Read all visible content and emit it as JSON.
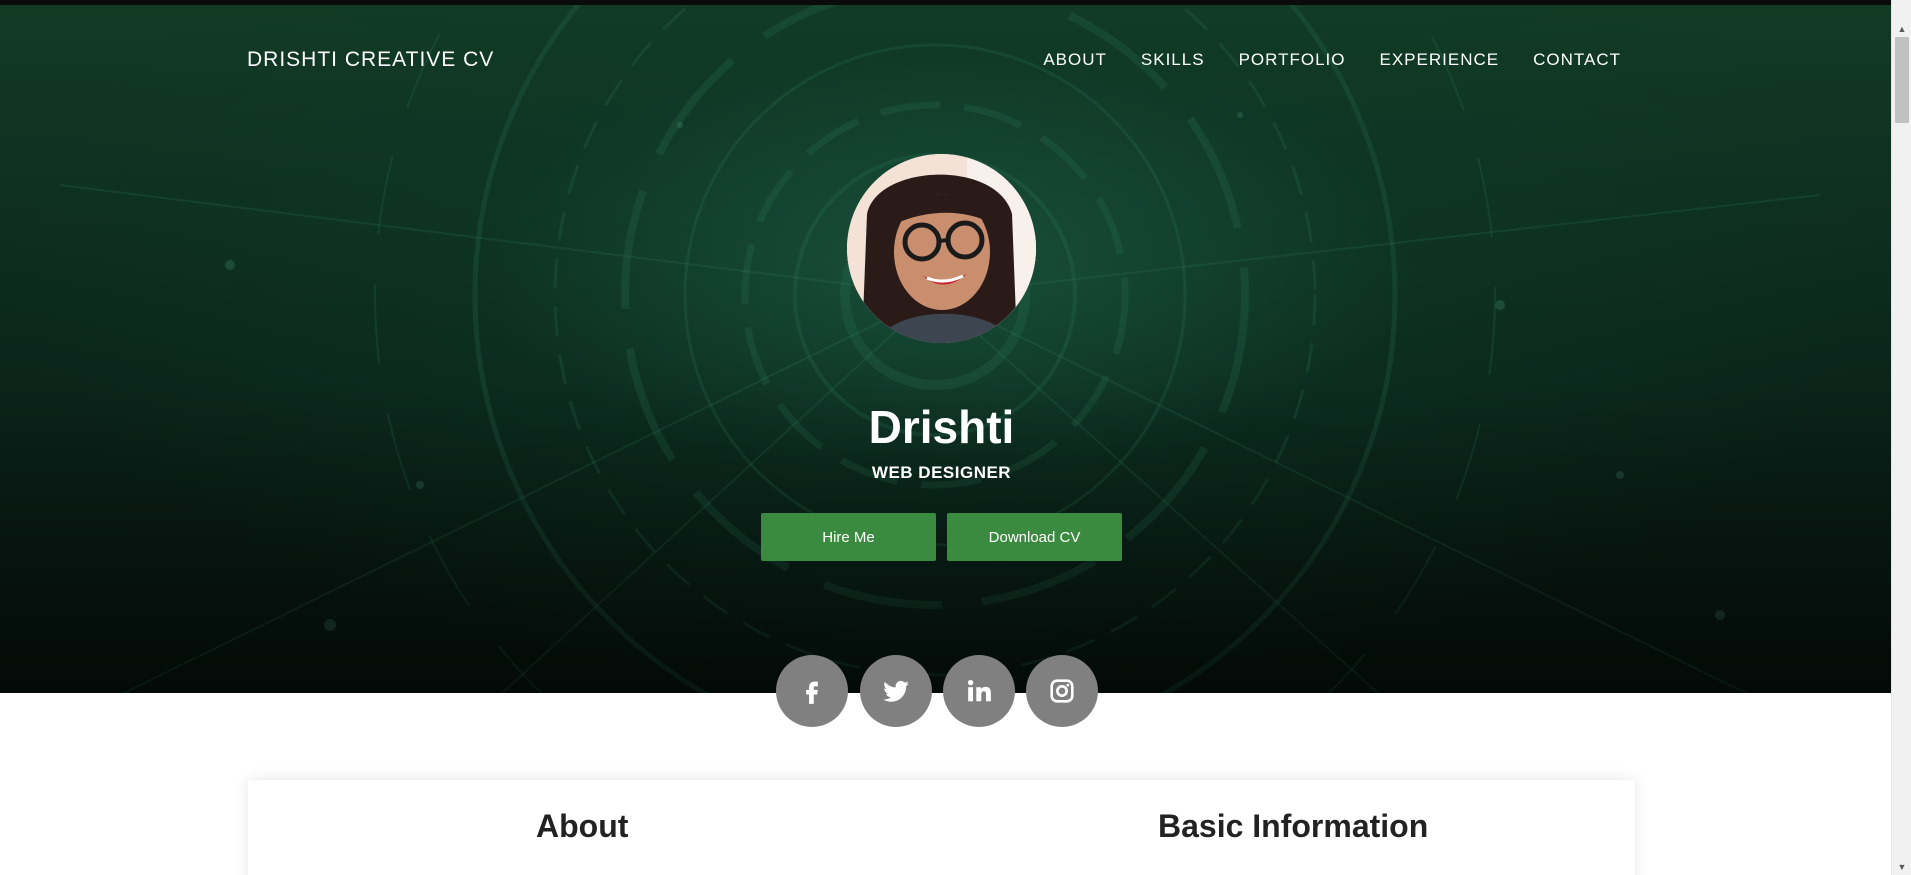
{
  "nav": {
    "brand": "DRISHTI CREATIVE CV",
    "items": [
      {
        "label": "ABOUT"
      },
      {
        "label": "SKILLS"
      },
      {
        "label": "PORTFOLIO"
      },
      {
        "label": "EXPERIENCE"
      },
      {
        "label": "CONTACT"
      }
    ]
  },
  "hero": {
    "name": "Drishti",
    "role": "WEB DESIGNER",
    "buttons": {
      "hire": "Hire Me",
      "download": "Download CV"
    }
  },
  "social": [
    {
      "icon": "facebook-icon"
    },
    {
      "icon": "twitter-icon"
    },
    {
      "icon": "linkedin-icon"
    },
    {
      "icon": "instagram-icon"
    }
  ],
  "sections": {
    "about_title": "About",
    "basic_title": "Basic Information"
  },
  "colors": {
    "hero_dark_green": "#0d2d20",
    "button_green": "#3a8a40",
    "social_gray": "#808080"
  }
}
